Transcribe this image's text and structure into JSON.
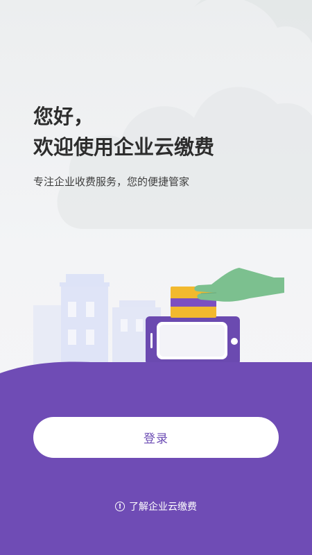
{
  "header": {
    "greeting_line1": "您好，",
    "greeting_line2": "欢迎使用企业云缴费",
    "subtitle": "专注企业收费服务，您的便捷管家"
  },
  "actions": {
    "login_label": "登录",
    "learn_more_label": "了解企业云缴费"
  },
  "icons": {
    "info": "info-icon"
  },
  "colors": {
    "brand_purple": "#6f4cb5",
    "accent_green": "#7cc08f",
    "card_yellow": "#f2b92e",
    "building_blue": "#dfe4f7"
  }
}
